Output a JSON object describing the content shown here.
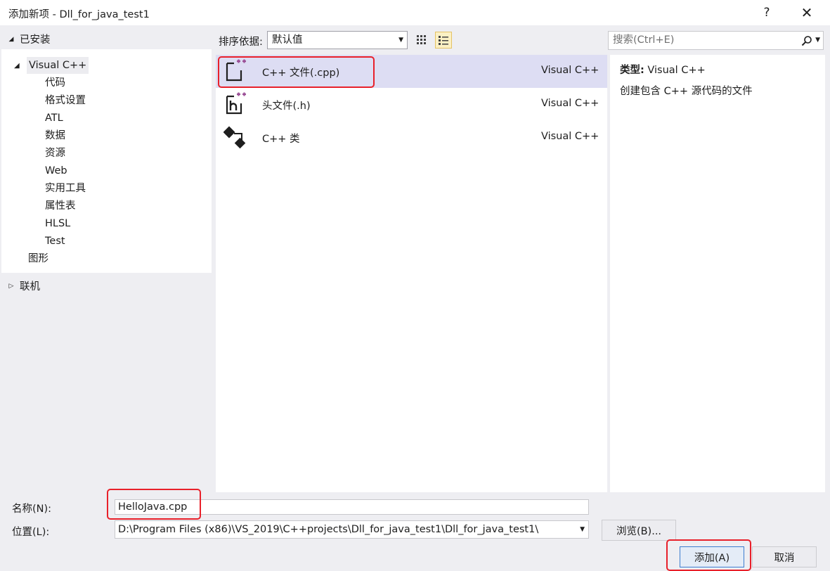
{
  "window": {
    "title": "添加新项 - Dll_for_java_test1",
    "help_label": "?",
    "close_label": "✕"
  },
  "left": {
    "installed_label": "已安装",
    "root_label": "Visual C++",
    "children": [
      "代码",
      "格式设置",
      "ATL",
      "数据",
      "资源",
      "Web",
      "实用工具",
      "属性表",
      "HLSL",
      "Test"
    ],
    "graphics_label": "图形",
    "online_label": "联机"
  },
  "toolbar": {
    "sort_label": "排序依据:",
    "sort_value": "默认值",
    "search_placeholder": "搜索(Ctrl+E)"
  },
  "templates": [
    {
      "name": "C++ 文件(.cpp)",
      "lang": "Visual C++",
      "icon": "cpp-file-icon",
      "selected": true
    },
    {
      "name": "头文件(.h)",
      "lang": "Visual C++",
      "icon": "header-file-icon",
      "selected": false
    },
    {
      "name": "C++ 类",
      "lang": "Visual C++",
      "icon": "cpp-class-icon",
      "selected": false
    }
  ],
  "details": {
    "type_label": "类型:",
    "type_value": "Visual C++",
    "description": "创建包含 C++ 源代码的文件"
  },
  "form": {
    "name_label": "名称(N):",
    "name_value": "HelloJava.cpp",
    "location_label": "位置(L):",
    "location_value": "D:\\Program Files (x86)\\VS_2019\\C++projects\\Dll_for_java_test1\\Dll_for_java_test1\\",
    "browse_label": "浏览(B)...",
    "add_label": "添加(A)",
    "cancel_label": "取消"
  },
  "colors": {
    "selection": "#ddddf3",
    "highlight": "#e8202a",
    "icon_purple": "#9b4f96"
  }
}
